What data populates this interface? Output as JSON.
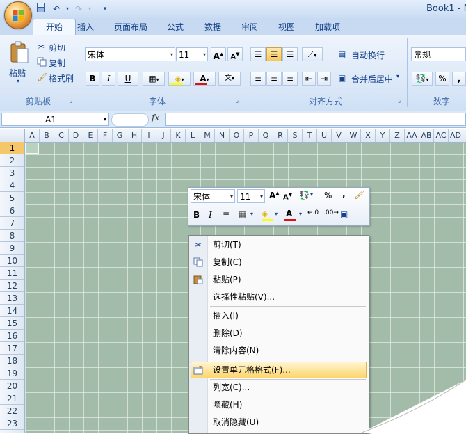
{
  "title_bar": {
    "book_title": "Book1 - M"
  },
  "quick_access": {
    "save_icon": "save-icon",
    "undo_icon": "undo-icon",
    "redo_icon": "redo-icon",
    "customize_icon": "customize-icon"
  },
  "tabs": [
    "开始",
    "插入",
    "页面布局",
    "公式",
    "数据",
    "审阅",
    "视图",
    "加载项"
  ],
  "ribbon": {
    "clipboard": {
      "paste": "粘贴",
      "cut": "剪切",
      "copy": "复制",
      "format_painter": "格式刷",
      "label": "剪贴板"
    },
    "font": {
      "name": "宋体",
      "size": "11",
      "bold": "B",
      "italic": "I",
      "underline": "U",
      "label": "字体",
      "grow": "A",
      "shrink": "A",
      "font_color_letter": "A"
    },
    "alignment": {
      "wrap_text": "自动换行",
      "merge_center": "合并后居中",
      "label": "对齐方式"
    },
    "number": {
      "format": "常规",
      "percent": "%",
      "comma": ",",
      "label": "数字"
    }
  },
  "formula_bar": {
    "name_box": "A1",
    "fx": "fx"
  },
  "columns": [
    "A",
    "B",
    "C",
    "D",
    "E",
    "F",
    "G",
    "H",
    "I",
    "J",
    "K",
    "L",
    "M",
    "N",
    "O",
    "P",
    "Q",
    "R",
    "S",
    "T",
    "U",
    "V",
    "W",
    "X",
    "Y",
    "Z",
    "AA",
    "AB",
    "AC",
    "AD"
  ],
  "rows": [
    "1",
    "2",
    "3",
    "4",
    "5",
    "6",
    "7",
    "8",
    "9",
    "10",
    "11",
    "12",
    "13",
    "14",
    "15",
    "16",
    "17",
    "18",
    "19",
    "20",
    "21",
    "22",
    "23"
  ],
  "mini_toolbar": {
    "font": "宋体",
    "size": "11",
    "percent": "%",
    "comma": ",",
    "bold": "B",
    "italic": "I",
    "grow": "A",
    "shrink": "A",
    "font_color_letter": "A"
  },
  "context_menu": {
    "items": [
      "剪切(T)",
      "复制(C)",
      "粘贴(P)",
      "选择性粘贴(V)...",
      "插入(I)",
      "删除(D)",
      "清除内容(N)",
      "设置单元格格式(F)...",
      "列宽(C)...",
      "隐藏(H)",
      "取消隐藏(U)"
    ]
  },
  "colors": {
    "grid_bg": "#a3bca9",
    "ribbon_bg": "#dde9f8",
    "highlight": "#fcd56e",
    "active_row": "#f5c76a"
  }
}
